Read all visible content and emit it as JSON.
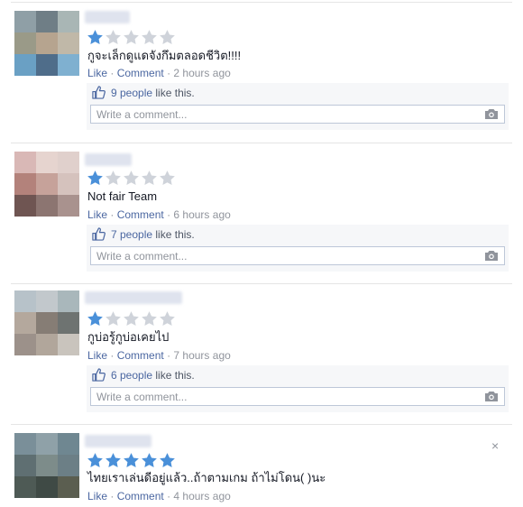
{
  "reviews": [
    {
      "rating": 1,
      "text": "กูจะเล็กดูแดจังกึมตลอดชีวิต!!!!",
      "actions": {
        "like": "Like",
        "separator": "·",
        "comment": "Comment",
        "time": "2 hours ago"
      },
      "likes": {
        "count_text": "9 people",
        "suffix": "like this."
      },
      "comment_placeholder": "Write a comment..."
    },
    {
      "rating": 1,
      "text": "Not fair Team",
      "actions": {
        "like": "Like",
        "separator": "·",
        "comment": "Comment",
        "time": "6 hours ago"
      },
      "likes": {
        "count_text": "7 people",
        "suffix": "like this."
      },
      "comment_placeholder": "Write a comment..."
    },
    {
      "rating": 1,
      "text": "กูบ่อรู้กูบ่อเคยไป",
      "actions": {
        "like": "Like",
        "separator": "·",
        "comment": "Comment",
        "time": "7 hours ago"
      },
      "likes": {
        "count_text": "6 people",
        "suffix": "like this."
      },
      "comment_placeholder": "Write a comment..."
    },
    {
      "rating": 5,
      "text": "ไทยเราเล่นดีอยู่แล้ว..ถ้าตามเกม ถ้าไม่โดน( )นะ",
      "actions": {
        "like": "Like",
        "separator": "·",
        "comment": "Comment",
        "time": "4 hours ago"
      },
      "close_icon": "×"
    }
  ],
  "colors": {
    "star_filled": "#4a90d9",
    "star_empty": "#cfd3da",
    "link": "#4b67a1",
    "meta": "#90949c"
  },
  "icons": [
    "star-icon",
    "thumbs-up-icon",
    "camera-icon",
    "close-icon"
  ]
}
